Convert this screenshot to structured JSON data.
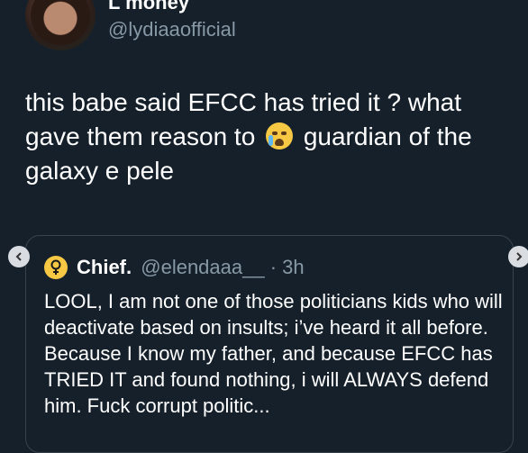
{
  "tweet": {
    "display_name": "L money",
    "handle": "@lydiaaofficial",
    "text_part1": "this babe said EFCC has tried it ? what gave them reason to",
    "text_part2": "guardian of the galaxy e pele",
    "emoji": "crying-face"
  },
  "quoted_tweet": {
    "name": "Chief.",
    "handle": "@elendaaa__",
    "separator": "·",
    "time": "3h",
    "text": "LOOL, I am not one of those politicians kids who will deactivate based on insults; i’ve heard it all before. Because I know my father, and because EFCC has TRIED IT and found nothing, i will ALWAYS defend him. Fuck corrupt politic..."
  },
  "icons": {
    "caret": "chevron-down-icon",
    "prev": "chevron-left-icon",
    "next": "chevron-right-icon",
    "quoted_avatar": "female-symbol-icon"
  },
  "colors": {
    "background": "#15202b",
    "secondary_text": "#8899a6",
    "border": "#38444d"
  }
}
